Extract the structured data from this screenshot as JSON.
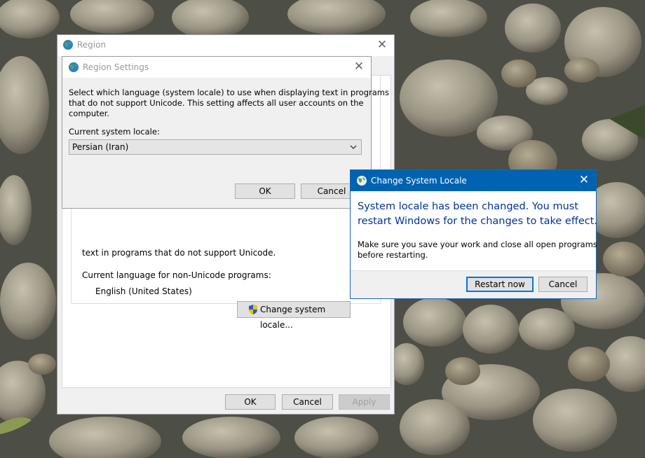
{
  "region_window": {
    "title": "Region",
    "description_line1": "text in programs that do not support Unicode.",
    "current_language_label": "Current language for non-Unicode programs:",
    "current_language_value": "English (United States)",
    "change_locale_button": "Change system locale...",
    "ok_button": "OK",
    "cancel_button": "Cancel",
    "apply_button": "Apply"
  },
  "region_settings_dialog": {
    "title": "Region Settings",
    "description_line1": "Select which language (system locale) to use when displaying text in programs",
    "description_line2": "that do not support Unicode. This setting affects all user accounts on the",
    "description_line3": "computer.",
    "current_locale_label": "Current system locale:",
    "locale_selected": "Persian (Iran)",
    "ok_button": "OK",
    "cancel_button": "Cancel"
  },
  "change_locale_dialog": {
    "title": "Change System Locale",
    "main_line1": "System locale has been changed. You must",
    "main_line2": "restart Windows for the changes to take effect.",
    "sub_line1": "Make sure you save your work and close all open programs",
    "sub_line2": "before restarting.",
    "restart_button": "Restart now",
    "cancel_button": "Cancel"
  },
  "colors": {
    "accent": "#0063b1",
    "main_instruction": "#003399"
  }
}
